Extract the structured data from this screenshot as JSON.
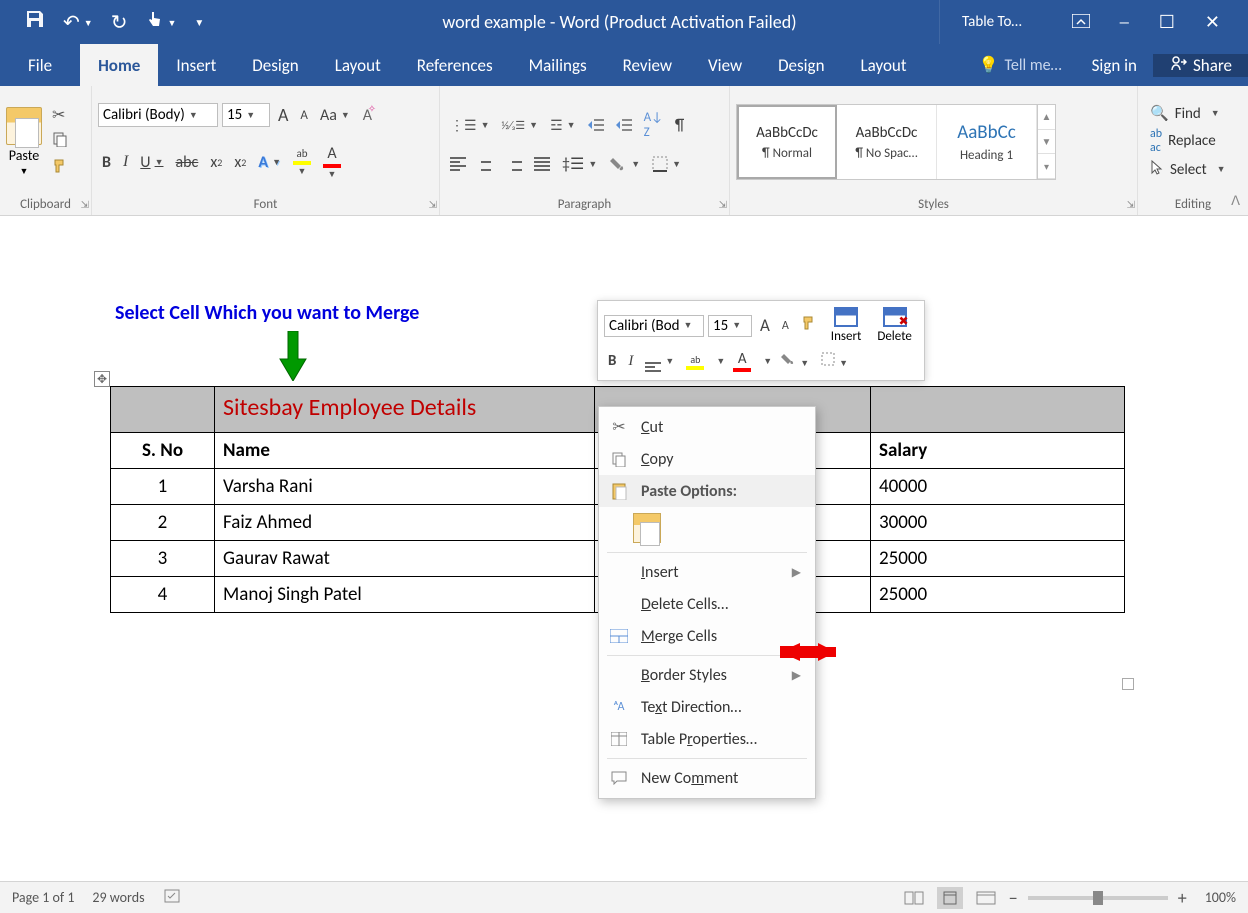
{
  "titlebar": {
    "title": "word example - Word (Product Activation Failed)",
    "table_tools": "Table To…"
  },
  "tabs": {
    "file": "File",
    "home": "Home",
    "insert": "Insert",
    "design": "Design",
    "layout": "Layout",
    "references": "References",
    "mailings": "Mailings",
    "review": "Review",
    "view": "View",
    "tdesign": "Design",
    "tlayout": "Layout",
    "tellme": "Tell me…",
    "signin": "Sign in",
    "share": "Share"
  },
  "ribbon": {
    "clipboard": {
      "paste": "Paste",
      "label": "Clipboard"
    },
    "font": {
      "name": "Calibri (Body)",
      "size": "15",
      "label": "Font",
      "A_up": "A",
      "A_dn": "A",
      "Aa": "Aa",
      "B": "B",
      "I": "I",
      "U": "U",
      "abc": "abc",
      "x2sub": "x",
      "x2sup": "x",
      "A_effects": "A",
      "A_hl": "A",
      "A_color": "A"
    },
    "paragraph": {
      "label": "Paragraph"
    },
    "styles": {
      "label": "Styles",
      "preview": "AaBbCcDc",
      "normal": "¶ Normal",
      "nospacing": "¶ No Spac…",
      "heading1": "Heading 1",
      "hpreview": "AaBbCc"
    },
    "editing": {
      "find": "Find",
      "replace": "Replace",
      "select": "Select",
      "label": "Editing"
    }
  },
  "annotation": "Select Cell Which you want to Merge",
  "table": {
    "title": "Sitesbay Employee Details",
    "headers": {
      "sno": "S. No",
      "name": "Name",
      "salary": "Salary"
    },
    "rows": [
      {
        "sno": "1",
        "name": "Varsha Rani",
        "salary": "40000"
      },
      {
        "sno": "2",
        "name": "Faiz Ahmed",
        "salary": "30000"
      },
      {
        "sno": "3",
        "name": "Gaurav Rawat",
        "salary": "25000"
      },
      {
        "sno": "4",
        "name": "Manoj Singh Patel",
        "salary": "25000"
      }
    ]
  },
  "mini": {
    "font": "Calibri (Bod",
    "size": "15",
    "insert": "Insert",
    "delete": "Delete",
    "B": "B",
    "I": "I",
    "A": "A"
  },
  "ctx": {
    "cut": "Cut",
    "copy": "Copy",
    "paste_options": "Paste Options:",
    "insert": "Insert",
    "delete_cells": "Delete Cells…",
    "merge_cells": "Merge Cells",
    "border_styles": "Border Styles",
    "text_direction": "Text Direction…",
    "table_properties": "Table Properties…",
    "new_comment": "New Comment"
  },
  "status": {
    "page": "Page 1 of 1",
    "words": "29 words",
    "zoom": "100%"
  }
}
